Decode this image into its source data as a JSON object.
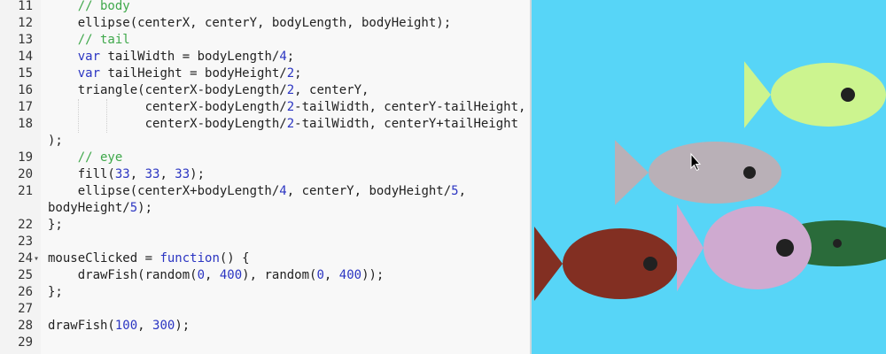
{
  "editor": {
    "lines": [
      {
        "n": "11",
        "code": "    // body"
      },
      {
        "n": "12",
        "code": "    ellipse(centerX, centerY, bodyLength, bodyHeight);"
      },
      {
        "n": "13",
        "code": "    // tail"
      },
      {
        "n": "14",
        "code": "    var tailWidth = bodyLength/4;"
      },
      {
        "n": "15",
        "code": "    var tailHeight = bodyHeight/2;"
      },
      {
        "n": "16",
        "code": "    triangle(centerX-bodyLength/2, centerY,"
      },
      {
        "n": "17",
        "code": "             centerX-bodyLength/2-tailWidth, centerY-tailHeight,"
      },
      {
        "n": "18",
        "code": "             centerX-bodyLength/2-tailWidth, centerY+tailHeight"
      },
      {
        "n": "",
        "code": ");"
      },
      {
        "n": "19",
        "code": "    // eye"
      },
      {
        "n": "20",
        "code": "    fill(33, 33, 33);"
      },
      {
        "n": "21",
        "code": "    ellipse(centerX+bodyLength/4, centerY, bodyHeight/5,"
      },
      {
        "n": "",
        "code": "bodyHeight/5);"
      },
      {
        "n": "22",
        "code": "};"
      },
      {
        "n": "23",
        "code": ""
      },
      {
        "n": "24",
        "code": "mouseClicked = function() {",
        "fold": true
      },
      {
        "n": "25",
        "code": "    drawFish(random(0, 400), random(0, 400));"
      },
      {
        "n": "26",
        "code": "};"
      },
      {
        "n": "27",
        "code": ""
      },
      {
        "n": "28",
        "code": "drawFish(100, 300);"
      },
      {
        "n": "29",
        "code": ""
      }
    ],
    "fold_glyph": "▾"
  },
  "canvas": {
    "background": "#57d5f7",
    "fishes": [
      {
        "name": "fish-green-dark",
        "color": "#2a6b3a",
        "eye": "#212121"
      },
      {
        "name": "fish-brown",
        "color": "#822f22",
        "eye": "#212121"
      },
      {
        "name": "fish-pink",
        "color": "#cfaad0",
        "eye": "#212121"
      },
      {
        "name": "fish-lime",
        "color": "#ccf48f",
        "eye": "#212121"
      },
      {
        "name": "fish-gray",
        "color": "#b9b0b7",
        "eye": "#212121"
      }
    ],
    "cursor": "mouse-pointer-icon"
  }
}
